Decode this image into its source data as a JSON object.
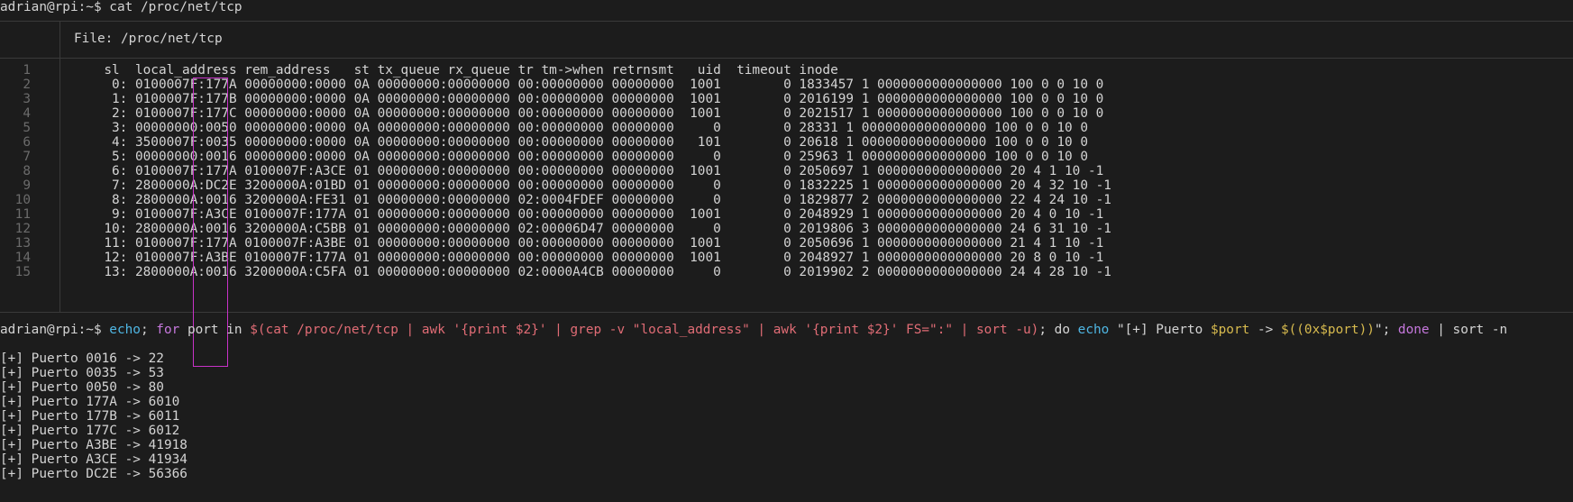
{
  "prompt1": {
    "ps1": "adrian@rpi:~$ ",
    "command": "cat /proc/net/tcp"
  },
  "bat": {
    "file_label": "File: /proc/net/tcp",
    "line_numbers": [
      "1",
      "2",
      "3",
      "4",
      "5",
      "6",
      "7",
      "8",
      "9",
      "10",
      "11",
      "12",
      "13",
      "14",
      "15"
    ],
    "lines": [
      "  sl  local_address rem_address   st tx_queue rx_queue tr tm->when retrnsmt   uid  timeout inode",
      "   0: 0100007F:177A 00000000:0000 0A 00000000:00000000 00:00000000 00000000  1001        0 1833457 1 0000000000000000 100 0 0 10 0",
      "   1: 0100007F:177B 00000000:0000 0A 00000000:00000000 00:00000000 00000000  1001        0 2016199 1 0000000000000000 100 0 0 10 0",
      "   2: 0100007F:177C 00000000:0000 0A 00000000:00000000 00:00000000 00000000  1001        0 2021517 1 0000000000000000 100 0 0 10 0",
      "   3: 00000000:0050 00000000:0000 0A 00000000:00000000 00:00000000 00000000     0        0 28331 1 0000000000000000 100 0 0 10 0",
      "   4: 3500007F:0035 00000000:0000 0A 00000000:00000000 00:00000000 00000000   101        0 20618 1 0000000000000000 100 0 0 10 0",
      "   5: 00000000:0016 00000000:0000 0A 00000000:00000000 00:00000000 00000000     0        0 25963 1 0000000000000000 100 0 0 10 0",
      "   6: 0100007F:177A 0100007F:A3CE 01 00000000:00000000 00:00000000 00000000  1001        0 2050697 1 0000000000000000 20 4 1 10 -1",
      "   7: 2800000A:DC2E 3200000A:01BD 01 00000000:00000000 00:00000000 00000000     0        0 1832225 1 0000000000000000 20 4 32 10 -1",
      "   8: 2800000A:0016 3200000A:FE31 01 00000000:00000000 02:0004FDEF 00000000     0        0 1829877 2 0000000000000000 22 4 24 10 -1",
      "   9: 0100007F:A3CE 0100007F:177A 01 00000000:00000000 00:00000000 00000000  1001        0 2048929 1 0000000000000000 20 4 0 10 -1",
      "  10: 2800000A:0016 3200000A:C5BB 01 00000000:00000000 02:00006D47 00000000     0        0 2019806 3 0000000000000000 24 6 31 10 -1",
      "  11: 0100007F:177A 0100007F:A3BE 01 00000000:00000000 00:00000000 00000000  1001        0 2050696 1 0000000000000000 21 4 1 10 -1",
      "  12: 0100007F:A3BE 0100007F:177A 01 00000000:00000000 00:00000000 00000000  1001        0 2048927 1 0000000000000000 20 8 0 10 -1",
      "  13: 2800000A:0016 3200000A:C5FA 01 00000000:00000000 02:0000A4CB 00000000     0        0 2019902 2 0000000000000000 24 4 28 10 -1"
    ]
  },
  "prompt2": {
    "ps1": "adrian@rpi:~$ ",
    "t1": "echo",
    "t2": "; ",
    "t3": "for",
    "t4": " port in ",
    "t5": "$(cat /proc/net/tcp | awk '{print $2}' | grep -v \"local_address\" | awk '{print $2}' FS=\":\" | sort -u)",
    "t6": "; do ",
    "t7": "echo",
    "t8": " \"[+] Puerto ",
    "t9": "$port",
    "t10": " -> ",
    "t11": "$((0x$port))",
    "t12": "\"; ",
    "t13": "done",
    "t14": " | sort -n"
  },
  "output": [
    "[+] Puerto 0016 -> 22",
    "[+] Puerto 0035 -> 53",
    "[+] Puerto 0050 -> 80",
    "[+] Puerto 177A -> 6010",
    "[+] Puerto 177B -> 6011",
    "[+] Puerto 177C -> 6012",
    "[+] Puerto A3BE -> 41918",
    "[+] Puerto A3CE -> 41934",
    "[+] Puerto DC2E -> 56366"
  ],
  "colors": {
    "bg": "#1c1c1c",
    "fg": "#d4d4d4",
    "highlight_box": "#c832c8",
    "builtin": "#4fb6e3",
    "keyword": "#c678dd",
    "subshell": "#e06c75",
    "variable": "#d7ba4e"
  }
}
